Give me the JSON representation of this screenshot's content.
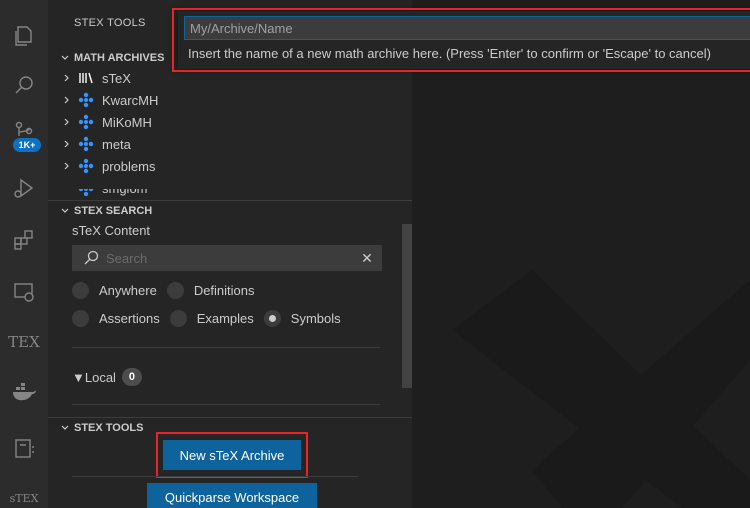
{
  "activity_bar": {
    "badge": "1K+",
    "tex_label": "TEX",
    "stex_label": "sTEX"
  },
  "sidebar": {
    "title": "STEX TOOLS",
    "math_archives": {
      "header": "MATH ARCHIVES",
      "items": [
        {
          "label": "sTeX",
          "icon": "library-icon"
        },
        {
          "label": "KwarcMH",
          "icon": "package-icon"
        },
        {
          "label": "MiKoMH",
          "icon": "package-icon"
        },
        {
          "label": "meta",
          "icon": "package-icon"
        },
        {
          "label": "problems",
          "icon": "package-icon"
        },
        {
          "label": "smglom",
          "icon": "package-icon"
        }
      ]
    },
    "stex_search": {
      "header": "STEX SEARCH",
      "content_label": "sTeX Content",
      "search_placeholder": "Search",
      "radios_row1": [
        {
          "label": "Anywhere",
          "selected": false
        },
        {
          "label": "Definitions",
          "selected": false
        }
      ],
      "radios_row2": [
        {
          "label": "Assertions",
          "selected": false
        },
        {
          "label": "Examples",
          "selected": false
        },
        {
          "label": "Symbols",
          "selected": true
        }
      ],
      "local_label": "▼Local",
      "local_count": "0"
    },
    "stex_tools": {
      "header": "STEX TOOLS",
      "new_archive_button": "New sTeX Archive",
      "quickparse_button": "Quickparse Workspace"
    }
  },
  "quick_input": {
    "placeholder": "My/Archive/Name",
    "message": "Insert the name of a new math archive here. (Press 'Enter' to confirm or 'Escape' to cancel)"
  },
  "colors": {
    "accent": "#0e639c",
    "highlight_outline": "#e5252a",
    "badge": "#0e70c0"
  }
}
